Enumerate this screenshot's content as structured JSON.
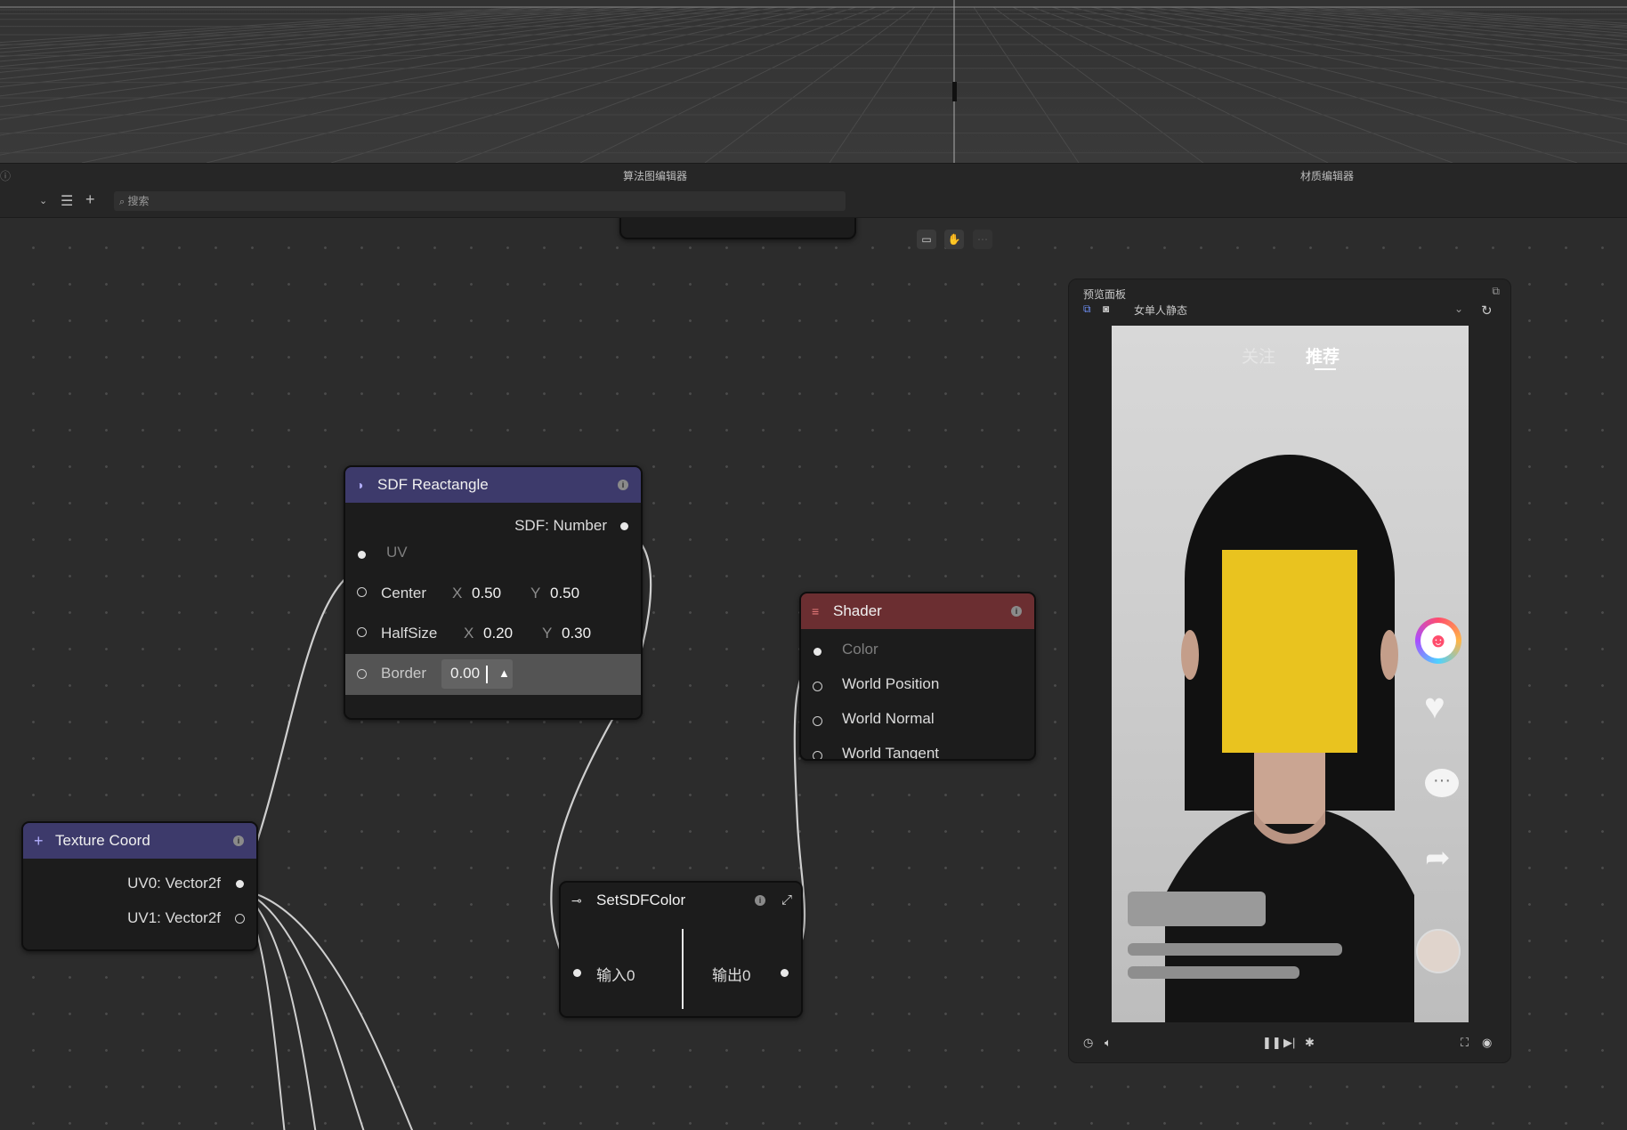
{
  "panels": {
    "algorithm_editor": "算法图编辑器",
    "material_editor": "材质编辑器"
  },
  "toolbar": {
    "search_placeholder": "搜索",
    "list_icon": "list-icon",
    "add_icon": "plus-icon"
  },
  "nodes": {
    "sdf_rect": {
      "title": "SDF Reactangle",
      "output": "SDF: Number",
      "uv": "UV",
      "center": {
        "label": "Center",
        "x_label": "X",
        "x": "0.50",
        "y_label": "Y",
        "y": "0.50"
      },
      "halfsize": {
        "label": "HalfSize",
        "x_label": "X",
        "x": "0.20",
        "y_label": "Y",
        "y": "0.30"
      },
      "border": {
        "label": "Border",
        "value": "0.00"
      }
    },
    "texture_coord": {
      "title": "Texture Coord",
      "uv0": "UV0: Vector2f",
      "uv1": "UV1: Vector2f"
    },
    "shader": {
      "title": "Shader",
      "inputs": [
        "Color",
        "World Position",
        "World Normal",
        "World Tangent"
      ]
    },
    "set_sdf_color": {
      "title": "SetSDFColor",
      "input0": "输入0",
      "output0": "输出0"
    }
  },
  "preview": {
    "title": "预览面板",
    "scene": "女单人静态",
    "tabs": {
      "follow": "关注",
      "recommend": "推荐"
    },
    "colors": {
      "yellow": "#e9c31f",
      "shader_head": "#6b2e31",
      "node_head": "#3d3a6b"
    }
  }
}
